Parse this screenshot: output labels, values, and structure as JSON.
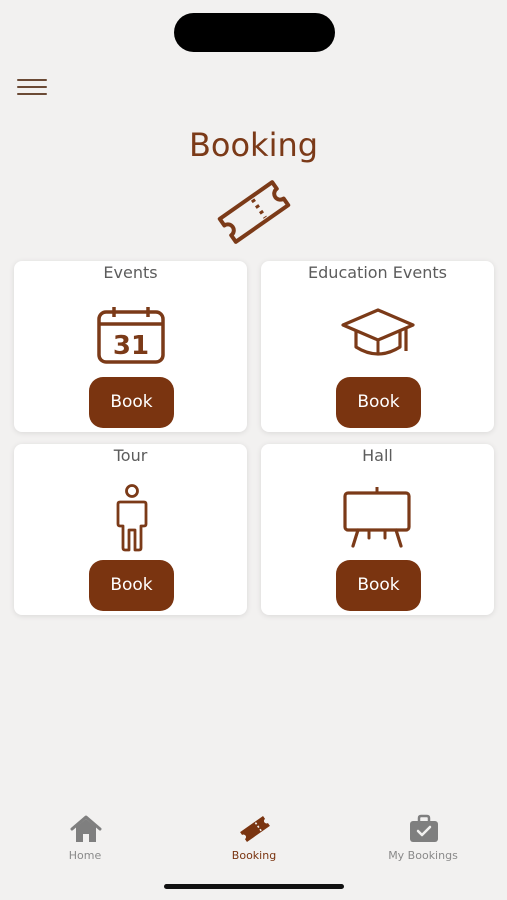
{
  "header": {
    "title": "Booking",
    "menu_icon": "hamburger-icon",
    "hero_icon": "ticket-icon"
  },
  "cards": [
    {
      "title": "Events",
      "icon": "calendar-icon",
      "icon_text": "31",
      "button": "Book"
    },
    {
      "title": "Education Events",
      "icon": "graduation-cap-icon",
      "button": "Book"
    },
    {
      "title": "Tour",
      "icon": "person-icon",
      "button": "Book"
    },
    {
      "title": "Hall",
      "icon": "easel-board-icon",
      "button": "Book"
    }
  ],
  "tabbar": {
    "items": [
      {
        "label": "Home",
        "icon": "home-icon",
        "active": false
      },
      {
        "label": "Booking",
        "icon": "ticket-icon",
        "active": true
      },
      {
        "label": "My Bookings",
        "icon": "briefcase-check-icon",
        "active": false
      }
    ]
  },
  "colors": {
    "accent": "#7a3410",
    "background": "#f2f1f0",
    "card": "#ffffff",
    "inactive_tab": "#8a8a8a"
  }
}
